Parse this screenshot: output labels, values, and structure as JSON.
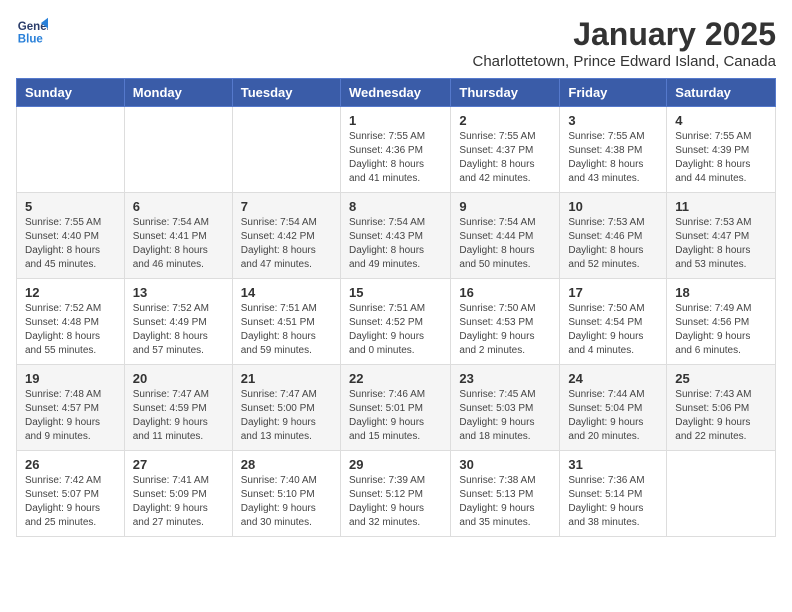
{
  "logo": {
    "line1": "General",
    "line2": "Blue"
  },
  "title": "January 2025",
  "subtitle": "Charlottetown, Prince Edward Island, Canada",
  "weekdays": [
    "Sunday",
    "Monday",
    "Tuesday",
    "Wednesday",
    "Thursday",
    "Friday",
    "Saturday"
  ],
  "weeks": [
    [
      {
        "day": "",
        "info": ""
      },
      {
        "day": "",
        "info": ""
      },
      {
        "day": "",
        "info": ""
      },
      {
        "day": "1",
        "info": "Sunrise: 7:55 AM\nSunset: 4:36 PM\nDaylight: 8 hours and 41 minutes."
      },
      {
        "day": "2",
        "info": "Sunrise: 7:55 AM\nSunset: 4:37 PM\nDaylight: 8 hours and 42 minutes."
      },
      {
        "day": "3",
        "info": "Sunrise: 7:55 AM\nSunset: 4:38 PM\nDaylight: 8 hours and 43 minutes."
      },
      {
        "day": "4",
        "info": "Sunrise: 7:55 AM\nSunset: 4:39 PM\nDaylight: 8 hours and 44 minutes."
      }
    ],
    [
      {
        "day": "5",
        "info": "Sunrise: 7:55 AM\nSunset: 4:40 PM\nDaylight: 8 hours and 45 minutes."
      },
      {
        "day": "6",
        "info": "Sunrise: 7:54 AM\nSunset: 4:41 PM\nDaylight: 8 hours and 46 minutes."
      },
      {
        "day": "7",
        "info": "Sunrise: 7:54 AM\nSunset: 4:42 PM\nDaylight: 8 hours and 47 minutes."
      },
      {
        "day": "8",
        "info": "Sunrise: 7:54 AM\nSunset: 4:43 PM\nDaylight: 8 hours and 49 minutes."
      },
      {
        "day": "9",
        "info": "Sunrise: 7:54 AM\nSunset: 4:44 PM\nDaylight: 8 hours and 50 minutes."
      },
      {
        "day": "10",
        "info": "Sunrise: 7:53 AM\nSunset: 4:46 PM\nDaylight: 8 hours and 52 minutes."
      },
      {
        "day": "11",
        "info": "Sunrise: 7:53 AM\nSunset: 4:47 PM\nDaylight: 8 hours and 53 minutes."
      }
    ],
    [
      {
        "day": "12",
        "info": "Sunrise: 7:52 AM\nSunset: 4:48 PM\nDaylight: 8 hours and 55 minutes."
      },
      {
        "day": "13",
        "info": "Sunrise: 7:52 AM\nSunset: 4:49 PM\nDaylight: 8 hours and 57 minutes."
      },
      {
        "day": "14",
        "info": "Sunrise: 7:51 AM\nSunset: 4:51 PM\nDaylight: 8 hours and 59 minutes."
      },
      {
        "day": "15",
        "info": "Sunrise: 7:51 AM\nSunset: 4:52 PM\nDaylight: 9 hours and 0 minutes."
      },
      {
        "day": "16",
        "info": "Sunrise: 7:50 AM\nSunset: 4:53 PM\nDaylight: 9 hours and 2 minutes."
      },
      {
        "day": "17",
        "info": "Sunrise: 7:50 AM\nSunset: 4:54 PM\nDaylight: 9 hours and 4 minutes."
      },
      {
        "day": "18",
        "info": "Sunrise: 7:49 AM\nSunset: 4:56 PM\nDaylight: 9 hours and 6 minutes."
      }
    ],
    [
      {
        "day": "19",
        "info": "Sunrise: 7:48 AM\nSunset: 4:57 PM\nDaylight: 9 hours and 9 minutes."
      },
      {
        "day": "20",
        "info": "Sunrise: 7:47 AM\nSunset: 4:59 PM\nDaylight: 9 hours and 11 minutes."
      },
      {
        "day": "21",
        "info": "Sunrise: 7:47 AM\nSunset: 5:00 PM\nDaylight: 9 hours and 13 minutes."
      },
      {
        "day": "22",
        "info": "Sunrise: 7:46 AM\nSunset: 5:01 PM\nDaylight: 9 hours and 15 minutes."
      },
      {
        "day": "23",
        "info": "Sunrise: 7:45 AM\nSunset: 5:03 PM\nDaylight: 9 hours and 18 minutes."
      },
      {
        "day": "24",
        "info": "Sunrise: 7:44 AM\nSunset: 5:04 PM\nDaylight: 9 hours and 20 minutes."
      },
      {
        "day": "25",
        "info": "Sunrise: 7:43 AM\nSunset: 5:06 PM\nDaylight: 9 hours and 22 minutes."
      }
    ],
    [
      {
        "day": "26",
        "info": "Sunrise: 7:42 AM\nSunset: 5:07 PM\nDaylight: 9 hours and 25 minutes."
      },
      {
        "day": "27",
        "info": "Sunrise: 7:41 AM\nSunset: 5:09 PM\nDaylight: 9 hours and 27 minutes."
      },
      {
        "day": "28",
        "info": "Sunrise: 7:40 AM\nSunset: 5:10 PM\nDaylight: 9 hours and 30 minutes."
      },
      {
        "day": "29",
        "info": "Sunrise: 7:39 AM\nSunset: 5:12 PM\nDaylight: 9 hours and 32 minutes."
      },
      {
        "day": "30",
        "info": "Sunrise: 7:38 AM\nSunset: 5:13 PM\nDaylight: 9 hours and 35 minutes."
      },
      {
        "day": "31",
        "info": "Sunrise: 7:36 AM\nSunset: 5:14 PM\nDaylight: 9 hours and 38 minutes."
      },
      {
        "day": "",
        "info": ""
      }
    ]
  ]
}
